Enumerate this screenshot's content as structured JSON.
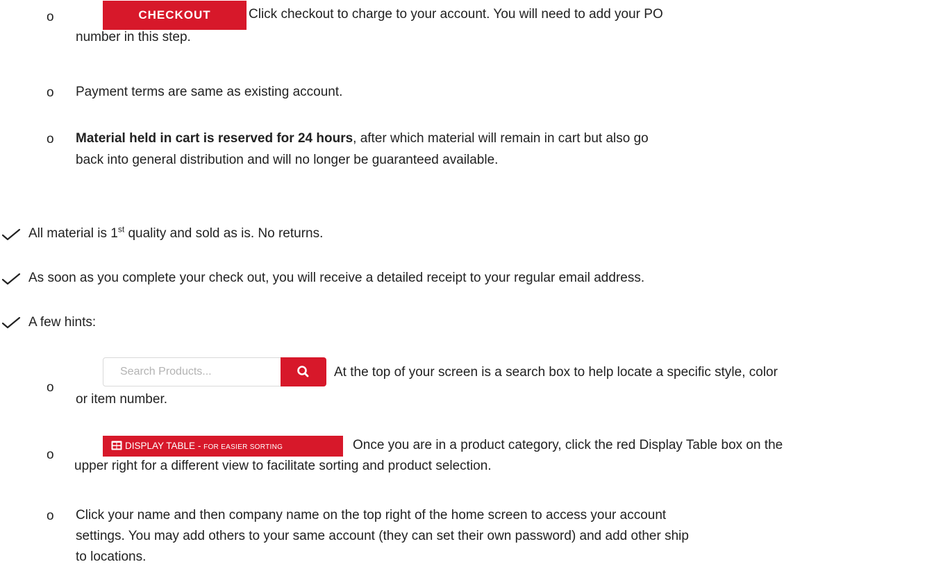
{
  "checkout_step": {
    "bullet": "o",
    "button_label": "CHECKOUT",
    "line1": "Click checkout to charge to your account. You will need to add your PO",
    "line2": "number in this step."
  },
  "payment_terms": {
    "bullet": "o",
    "text": "Payment terms are same as existing account."
  },
  "reserved_note": {
    "bullet": "o",
    "bold": "Material held in cart is reserved for 24 hours",
    "line1_rest": ", after which material will remain in cart but also go",
    "line2": "back into general distribution and will no longer be guaranteed available."
  },
  "checklist": [
    {
      "before": "All material is 1",
      "sup": "st",
      "after": " quality and sold as is. No returns."
    },
    {
      "text": "As soon as you complete your check out, you will receive a detailed receipt to your regular email address."
    },
    {
      "text": "A few hints:"
    }
  ],
  "hints": {
    "search": {
      "bullet": "o",
      "placeholder": "Search Products...",
      "icon": "search-icon",
      "line1": "At the top of your screen is a search box to help locate a specific style, color",
      "line2": "or item number."
    },
    "display_table": {
      "bullet": "o",
      "icon": "table-icon",
      "label_main": "DISPLAY TABLE",
      "label_sep": " - ",
      "label_small": "FOR EASIER SORTING",
      "line1": "Once you are in a product category, click the red Display Table box on the",
      "line2": "upper right for a different view to facilitate sorting and product selection."
    },
    "account": {
      "bullet": "o",
      "line1": "Click your name and then company name on the top right of the home screen to access your account",
      "line2": "settings. You may add others to your same account (they can set their own password) and add other ship",
      "line3": "to locations."
    }
  },
  "colors": {
    "accent": "#d7182a",
    "text": "#222222"
  }
}
